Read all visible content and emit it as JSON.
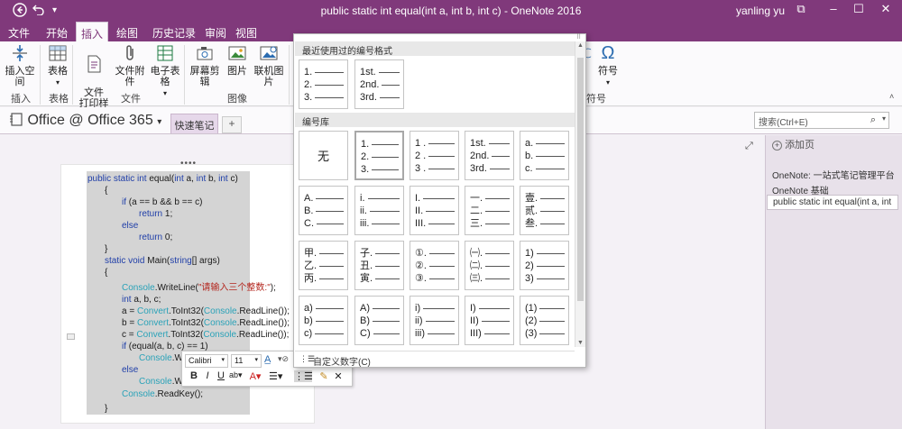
{
  "window": {
    "title": "public static int equal(int a, int b, int c)  -  OneNote 2016",
    "user": "yanling yu",
    "back_icon": "back-circle-icon",
    "undo_icon": "undo-icon"
  },
  "tabs": [
    {
      "label": "文件"
    },
    {
      "label": "开始"
    },
    {
      "label": "插入",
      "active": true
    },
    {
      "label": "绘图"
    },
    {
      "label": "历史记录"
    },
    {
      "label": "审阅"
    },
    {
      "label": "视图"
    }
  ],
  "ribbon": {
    "insert_space": "插入空间",
    "table": "表格",
    "file_printout": "文件\n打印样式",
    "file_attach": "文件附件",
    "spreadsheet": "电子表格",
    "screen_clip": "屏幕剪辑",
    "picture": "图片",
    "online_picture": "联机图片",
    "symbol": "符号",
    "groups": {
      "insert": "插入",
      "tables": "表格",
      "files": "文件",
      "images": "图像",
      "symbols": "符号"
    }
  },
  "notebook": {
    "name": "Office @ Office 365",
    "section_tab": "快速笔记",
    "add_tab": "+",
    "search_placeholder": "搜索(Ctrl+E)"
  },
  "pages": {
    "add_page": "添加页",
    "items": [
      "OneNote: 一站式笔记管理平台",
      "OneNote 基础",
      "public static int equal(int a, int"
    ]
  },
  "code": {
    "lines": [
      {
        "indent": 0,
        "parts": [
          [
            "kw",
            "public static int "
          ],
          [
            "",
            "equal("
          ],
          [
            "kw",
            "int"
          ],
          [
            "",
            " a, "
          ],
          [
            "kw",
            "int"
          ],
          [
            "",
            " b, "
          ],
          [
            "kw",
            "int"
          ],
          [
            "",
            " c)"
          ]
        ]
      },
      {
        "indent": 1,
        "parts": [
          [
            "",
            "{"
          ]
        ]
      },
      {
        "indent": 2,
        "parts": [
          [
            "kw",
            "if"
          ],
          [
            "",
            " (a == b && b == c)"
          ]
        ]
      },
      {
        "indent": 3,
        "parts": [
          [
            "kw",
            "return"
          ],
          [
            "",
            " 1;"
          ]
        ]
      },
      {
        "indent": 2,
        "parts": [
          [
            "kw",
            "else"
          ]
        ]
      },
      {
        "indent": 3,
        "parts": [
          [
            "kw",
            "return"
          ],
          [
            "",
            " 0;"
          ]
        ]
      },
      {
        "indent": 1,
        "parts": [
          [
            "",
            "}"
          ]
        ]
      },
      {
        "indent": 1,
        "parts": [
          [
            "kw",
            "static void "
          ],
          [
            "",
            "Main("
          ],
          [
            "kw",
            "string"
          ],
          [
            "",
            "[] args)"
          ]
        ]
      },
      {
        "indent": 1,
        "parts": [
          [
            "",
            "{"
          ]
        ]
      },
      {
        "indent": 2,
        "parts": [
          [
            "ty",
            "Console"
          ],
          [
            "",
            ".WriteLine("
          ],
          [
            "st",
            "\"请输入三个整数:\""
          ],
          [
            "",
            ");"
          ]
        ]
      },
      {
        "indent": 2,
        "parts": [
          [
            "kw",
            "int"
          ],
          [
            "",
            " a, b, c;"
          ]
        ]
      },
      {
        "indent": 2,
        "parts": [
          [
            "",
            "a = "
          ],
          [
            "ty",
            "Convert"
          ],
          [
            "",
            ".ToInt32("
          ],
          [
            "ty",
            "Console"
          ],
          [
            "",
            ".ReadLine());"
          ]
        ]
      },
      {
        "indent": 2,
        "parts": [
          [
            "",
            "b = "
          ],
          [
            "ty",
            "Convert"
          ],
          [
            "",
            ".ToInt32("
          ],
          [
            "ty",
            "Console"
          ],
          [
            "",
            ".ReadLine());"
          ]
        ]
      },
      {
        "indent": 2,
        "parts": [
          [
            "",
            "c = "
          ],
          [
            "ty",
            "Convert"
          ],
          [
            "",
            ".ToInt32("
          ],
          [
            "ty",
            "Console"
          ],
          [
            "",
            ".ReadLine());"
          ]
        ]
      },
      {
        "indent": 2,
        "parts": [
          [
            "kw",
            "if"
          ],
          [
            "",
            " (equal(a, b, c) == 1)"
          ]
        ]
      },
      {
        "indent": 3,
        "parts": [
          [
            "ty",
            "Console"
          ],
          [
            "",
            ".WriteL"
          ]
        ]
      },
      {
        "indent": 2,
        "parts": [
          [
            "kw",
            "else"
          ]
        ]
      },
      {
        "indent": 3,
        "parts": [
          [
            "ty",
            "Console"
          ],
          [
            "",
            ".WriteL"
          ]
        ]
      },
      {
        "indent": 2,
        "parts": [
          [
            "ty",
            "Console"
          ],
          [
            "",
            ".ReadKey();"
          ]
        ]
      },
      {
        "indent": 1,
        "parts": [
          [
            "",
            "}"
          ]
        ]
      }
    ]
  },
  "mini_toolbar": {
    "font": "Calibri",
    "size": "11",
    "bold": "B",
    "italic": "I",
    "underline": "U"
  },
  "numbering_gallery": {
    "recent_header": "最近使用过的编号格式",
    "library_header": "编号库",
    "none_label": "无",
    "custom_label": "自定义数字(C)",
    "recent": [
      [
        "1.",
        "2.",
        "3."
      ],
      [
        "1st.",
        "2nd.",
        "3rd."
      ]
    ],
    "library": [
      [
        [
          "1.",
          "2.",
          "3."
        ],
        [
          "1 .",
          "2 .",
          "3 ."
        ],
        [
          "1st.",
          "2nd.",
          "3rd."
        ],
        [
          "a.",
          "b.",
          "c."
        ]
      ],
      [
        [
          "A.",
          "B.",
          "C."
        ],
        [
          "i.",
          "ii.",
          "iii."
        ],
        [
          "I.",
          "II.",
          "III."
        ],
        [
          "一.",
          "二.",
          "三."
        ],
        [
          "壹.",
          "贰.",
          "叁."
        ]
      ],
      [
        [
          "甲.",
          "乙.",
          "丙."
        ],
        [
          "子.",
          "丑.",
          "寅."
        ],
        [
          "①.",
          "②.",
          "③."
        ],
        [
          "㈠.",
          "㈡.",
          "㈢."
        ],
        [
          "1)",
          "2)",
          "3)"
        ]
      ],
      [
        [
          "a)",
          "b)",
          "c)"
        ],
        [
          "A)",
          "B)",
          "C)"
        ],
        [
          "i)",
          "ii)",
          "iii)"
        ],
        [
          "I)",
          "II)",
          "III)"
        ],
        [
          "(1)",
          "(2)",
          "(3)"
        ]
      ]
    ]
  },
  "colors": {
    "accent": "#80397b",
    "keyword": "#1f3ea8",
    "string": "#b3261e",
    "type": "#2aa2b8"
  }
}
